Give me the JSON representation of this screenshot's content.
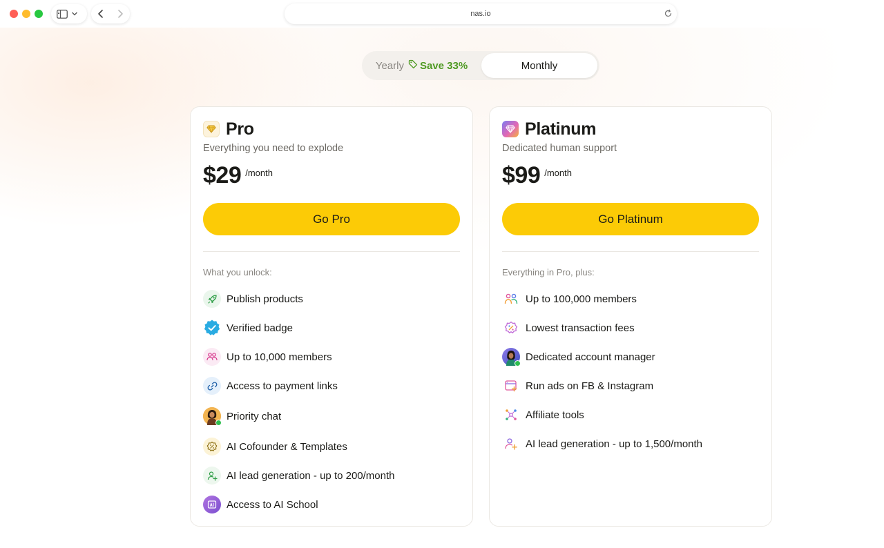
{
  "browser": {
    "url": "nas.io"
  },
  "billing_toggle": {
    "yearly_label": "Yearly",
    "save_label": "Save 33%",
    "monthly_label": "Monthly",
    "selected": "Monthly"
  },
  "colors": {
    "accent_yellow": "#fccb06",
    "save_green": "#4f9a23"
  },
  "plans": [
    {
      "name": "Pro",
      "icon": "diamond-icon",
      "subtitle": "Everything you need to explode",
      "price": "$29",
      "period": "/month",
      "cta": "Go Pro",
      "features_heading": "What you unlock:",
      "features": [
        {
          "icon": "rocket-icon",
          "label": "Publish products"
        },
        {
          "icon": "verified-badge-icon",
          "label": "Verified badge"
        },
        {
          "icon": "members-icon",
          "label": "Up to 10,000 members"
        },
        {
          "icon": "payment-link-icon",
          "label": "Access to payment links"
        },
        {
          "icon": "avatar-chat-icon",
          "label": "Priority chat"
        },
        {
          "icon": "ai-cofounder-icon",
          "label": "AI Cofounder & Templates"
        },
        {
          "icon": "lead-generation-icon",
          "label": "AI lead generation - up to 200/month"
        },
        {
          "icon": "ai-school-icon",
          "label": "Access to AI School"
        }
      ]
    },
    {
      "name": "Platinum",
      "icon": "gem-icon",
      "subtitle": "Dedicated human support",
      "price": "$99",
      "period": "/month",
      "cta": "Go Platinum",
      "features_heading": "Everything in Pro, plus:",
      "features": [
        {
          "icon": "members-icon",
          "label": "Up to 100,000 members"
        },
        {
          "icon": "transaction-fee-icon",
          "label": "Lowest transaction fees"
        },
        {
          "icon": "account-manager-icon",
          "label": "Dedicated account manager"
        },
        {
          "icon": "ads-icon",
          "label": "Run ads on FB & Instagram"
        },
        {
          "icon": "affiliate-icon",
          "label": "Affiliate tools"
        },
        {
          "icon": "lead-generation-icon",
          "label": "AI lead generation - up to 1,500/month"
        }
      ]
    }
  ]
}
